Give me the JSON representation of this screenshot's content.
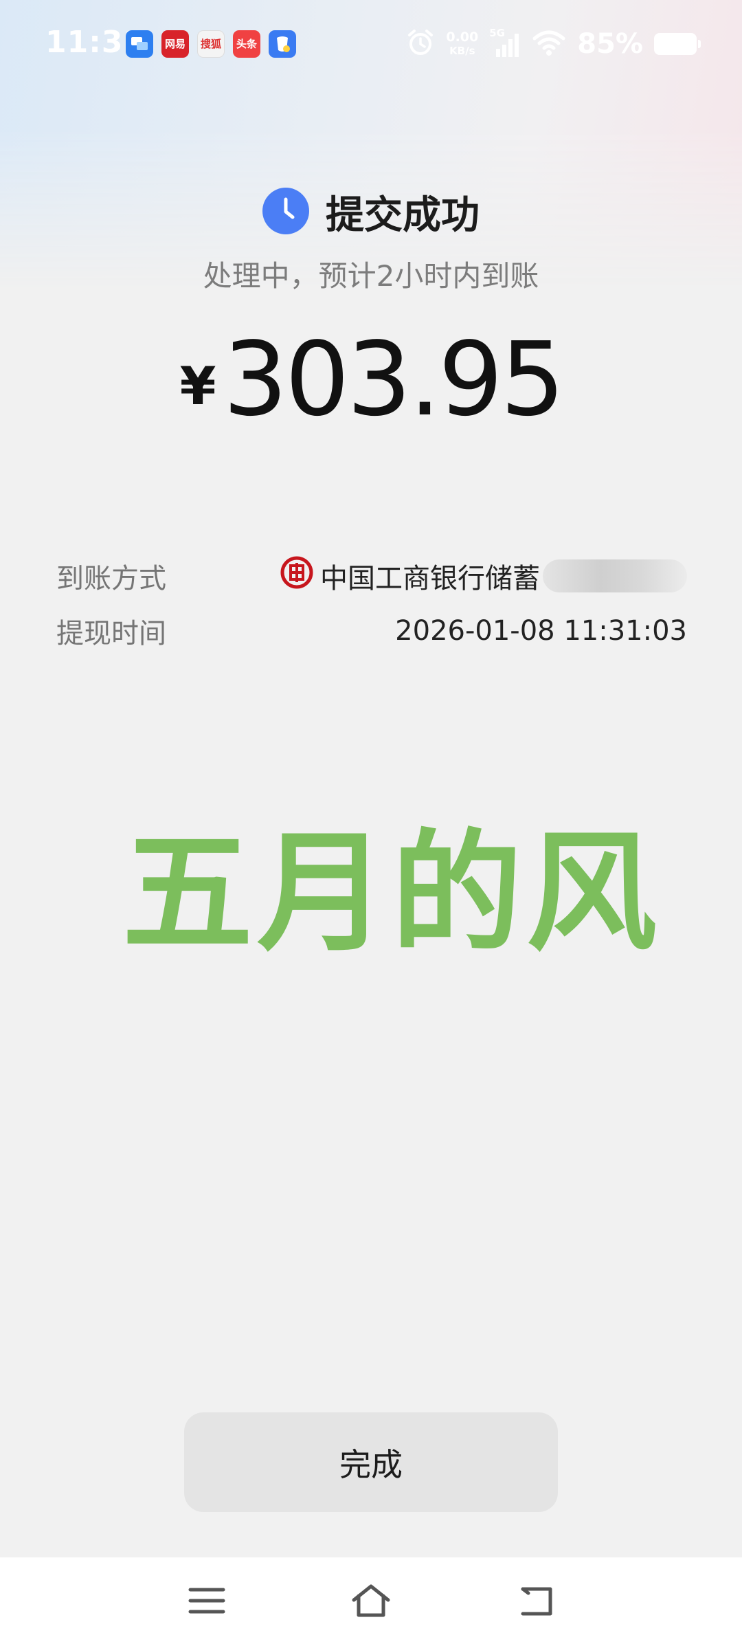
{
  "status_bar": {
    "time": "11:31",
    "apps": [
      {
        "icon": "message-app-icon",
        "text": "",
        "bg": "#2d7ff0"
      },
      {
        "icon": "netease-news-icon",
        "text": "网易",
        "bg": "#d8232a"
      },
      {
        "icon": "sohu-news-icon",
        "text": "搜狐",
        "bg": "#f4f4f4"
      },
      {
        "icon": "toutiao-icon",
        "text": "头条",
        "bg": "#f04142"
      },
      {
        "icon": "baidu-app-icon",
        "text": "",
        "bg": "#3a7bf2"
      }
    ],
    "net_speed_value": "0.00",
    "net_speed_unit": "KB/s",
    "network": "5G",
    "battery": "85%"
  },
  "header": {
    "title": "提交成功",
    "subtitle": "处理中，预计2小时内到账",
    "status_icon": "clock-icon",
    "accent_color": "#4b7ef5"
  },
  "amount": {
    "currency": "¥",
    "value": "303.95"
  },
  "details": {
    "method_label": "到账方式",
    "method_value": "中国工商银行储蓄",
    "method_icon": "icbc-logo-icon",
    "time_label": "提现时间",
    "time_value": "2026-01-08 11:31:03"
  },
  "watermark": {
    "text": "五月的风",
    "color": "#7cbe5c"
  },
  "done_button": {
    "label": "完成"
  },
  "nav_bar": {
    "menu_icon": "menu-icon",
    "home_icon": "home-icon",
    "back_icon": "back-icon"
  }
}
